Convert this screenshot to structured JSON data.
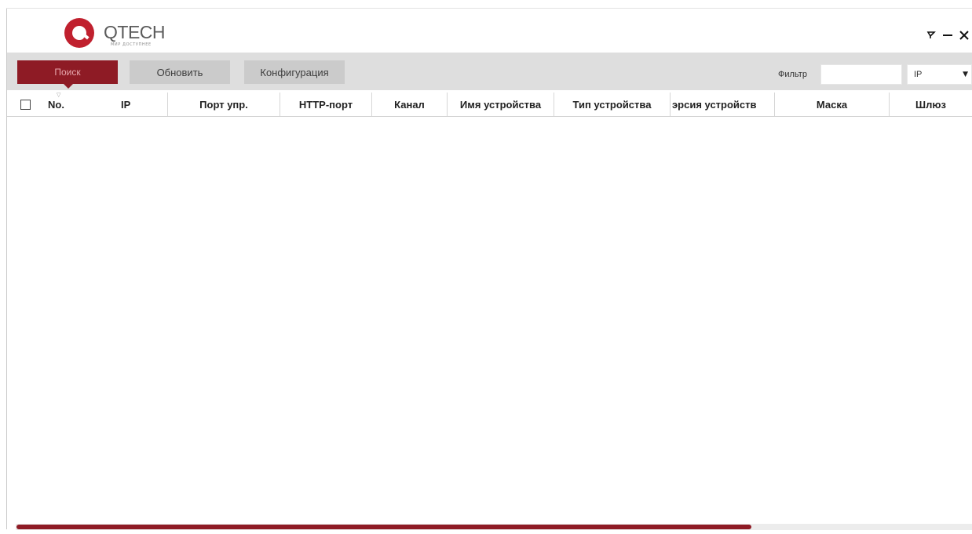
{
  "app": {
    "logo_text": "QTECH",
    "logo_tagline": "МИР ДОСТУПНЕЕ",
    "colors": {
      "brand": "#c0202e",
      "accent_dark": "#8e1b25",
      "toolbar_bg": "#dedede"
    }
  },
  "window_controls": {
    "pin_glyph": "⊸",
    "minimize_glyph": "—",
    "close_glyph": "✕"
  },
  "toolbar": {
    "search_label": "Поиск",
    "refresh_label": "Обновить",
    "config_label": "Конфигурация",
    "filter_label": "Фильтр",
    "filter_value": "",
    "filter_type_value": "IP",
    "dropdown_glyph": "▼"
  },
  "table": {
    "sort_glyph": "▽",
    "columns": [
      "No.",
      "IP",
      "Порт упр.",
      "HTTP-порт",
      "Канал",
      "Имя устройства",
      "Тип устройства",
      "эрсия устройств",
      "Маска",
      "Шлюз"
    ],
    "rows": []
  },
  "scrollbar": {
    "position": 0,
    "visible_fraction": 0.77
  }
}
